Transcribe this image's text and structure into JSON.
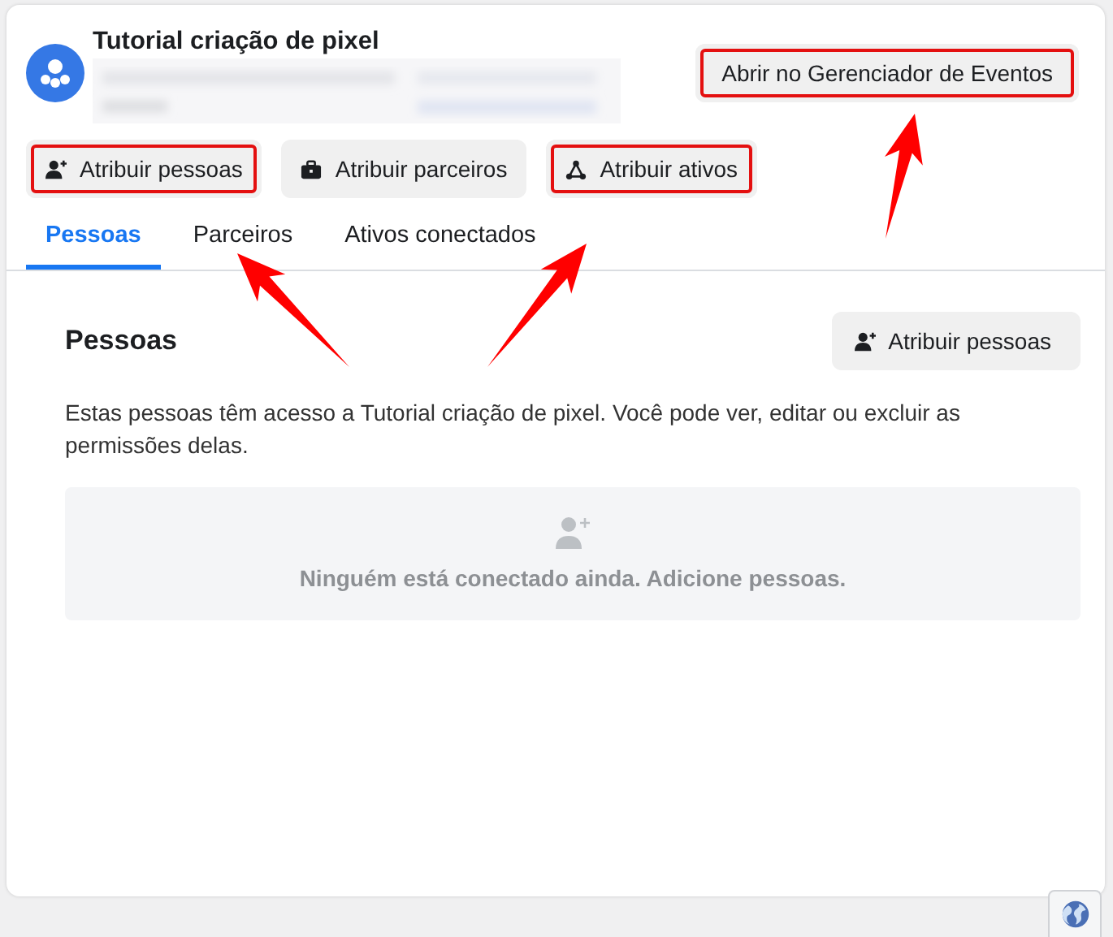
{
  "header": {
    "title": "Tutorial criação de pixel",
    "open_button": {
      "label": "Abrir no Gerenciador de Eventos",
      "highlighted": true
    }
  },
  "actions": [
    {
      "label": "Atribuir pessoas",
      "kind": "person",
      "highlighted": true
    },
    {
      "label": "Atribuir parceiros",
      "kind": "briefcase",
      "highlighted": false
    },
    {
      "label": "Atribuir ativos",
      "kind": "assets",
      "highlighted": true
    }
  ],
  "tabs": [
    {
      "label": "Pessoas",
      "selected": true
    },
    {
      "label": "Parceiros",
      "selected": false
    },
    {
      "label": "Ativos conectados",
      "selected": false
    }
  ],
  "section": {
    "title": "Pessoas",
    "button": {
      "label": "Atribuir pessoas",
      "kind": "person"
    },
    "description": "Estas pessoas têm acesso a Tutorial criação de pixel. Você pode ver, editar ou excluir as permissões delas.",
    "empty_message": "Ninguém está conectado ainda. Adicione pessoas."
  }
}
